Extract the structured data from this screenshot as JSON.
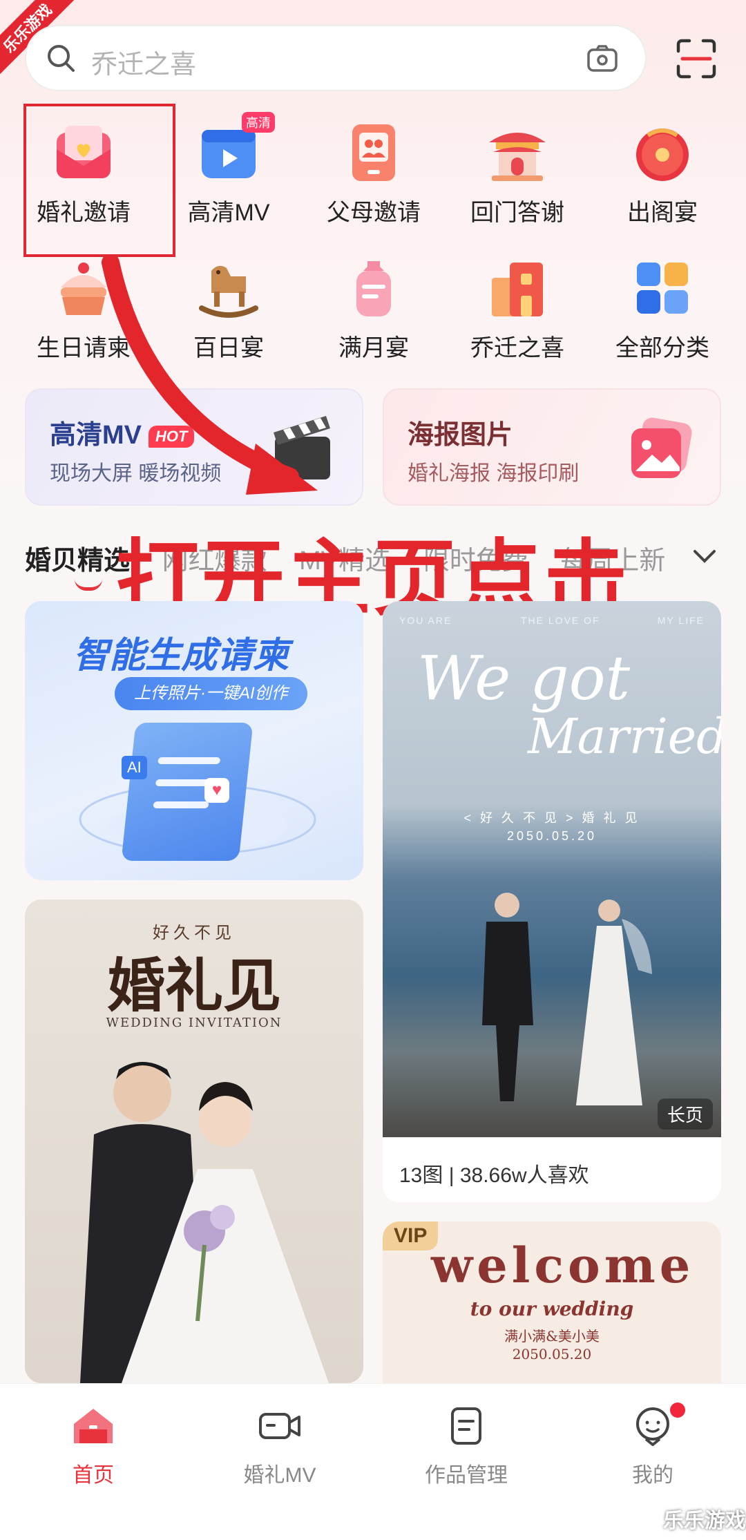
{
  "corner_ribbon": "乐乐游戏",
  "search": {
    "placeholder": "乔迁之喜"
  },
  "categories": [
    {
      "label": "婚礼邀请",
      "icon": "envelope-heart-icon"
    },
    {
      "label": "高清MV",
      "icon": "video-play-icon",
      "badge": "高清"
    },
    {
      "label": "父母邀请",
      "icon": "parents-card-icon"
    },
    {
      "label": "回门答谢",
      "icon": "pavilion-icon"
    },
    {
      "label": "出阁宴",
      "icon": "red-round-fan-icon"
    },
    {
      "label": "生日请柬",
      "icon": "cake-icon"
    },
    {
      "label": "百日宴",
      "icon": "rocking-horse-icon"
    },
    {
      "label": "满月宴",
      "icon": "baby-bottle-icon"
    },
    {
      "label": "乔迁之喜",
      "icon": "house-icon"
    },
    {
      "label": "全部分类",
      "icon": "grid-icon"
    }
  ],
  "promos": [
    {
      "title": "高清MV",
      "hot": "HOT",
      "subtitle": "现场大屏 暖场视频",
      "icon": "clapperboard-icon"
    },
    {
      "title": "海报图片",
      "subtitle": "婚礼海报 海报印刷",
      "icon": "picture-icon"
    }
  ],
  "tabs": [
    "婚贝精选",
    "网红爆款",
    "MV精选",
    "限时免费",
    "每周上新"
  ],
  "overlay_annotation": "打开主页点击",
  "cards": {
    "ai": {
      "title": "智能生成请柬",
      "pill": "上传照片·一键AI创作",
      "badge": "AI"
    },
    "wedding": {
      "top_left": "YOU ARE",
      "top_mid": "THE LOVE OF",
      "top_right": "MY LIFE",
      "script1": "We got",
      "script2": "Married",
      "sub1": "< 好 久 不 见 > 婚 礼 见",
      "sub2": "2050.05.20",
      "tag": "长页",
      "meta": "13图 | 38.66w人喜欢"
    },
    "invitation": {
      "small": "好久不见",
      "big": "婚礼见",
      "en": "WEDDING INVITATION"
    },
    "vip": {
      "badge": "VIP",
      "welcome": "welcome",
      "line1": "to our wedding",
      "line2": "满小满&美小美",
      "line3": "2050.05.20"
    }
  },
  "nav": [
    {
      "label": "首页",
      "icon": "home-icon",
      "active": true
    },
    {
      "label": "婚礼MV",
      "icon": "video-camera-icon"
    },
    {
      "label": "作品管理",
      "icon": "document-icon"
    },
    {
      "label": "我的",
      "icon": "profile-icon"
    }
  ],
  "watermark": "乐乐游戏",
  "colors": {
    "accent": "#e8323c",
    "annotation": "#e2262c",
    "ai_blue": "#2f6ee6"
  }
}
